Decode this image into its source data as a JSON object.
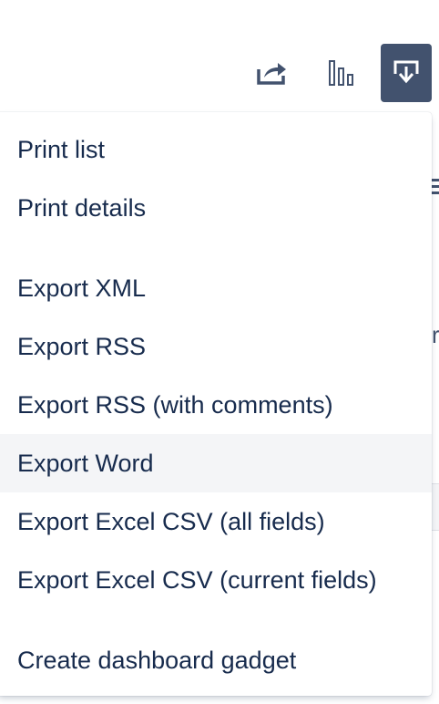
{
  "toolbar": {
    "icons": [
      "share-icon",
      "chart-icon",
      "export-icon"
    ],
    "export_button_color": "#42526e",
    "icon_color": "#42526e"
  },
  "background": {
    "partial_text": "r"
  },
  "dropdown": {
    "print_items": [
      {
        "label": "Print list"
      },
      {
        "label": "Print details"
      }
    ],
    "export_items": [
      {
        "label": "Export XML"
      },
      {
        "label": "Export RSS"
      },
      {
        "label": "Export RSS (with comments)"
      },
      {
        "label": "Export Word",
        "highlighted": true
      },
      {
        "label": "Export Excel CSV (all fields)"
      },
      {
        "label": "Export Excel CSV (current fields)"
      }
    ],
    "gadget_items": [
      {
        "label": "Create dashboard gadget"
      }
    ],
    "highlight_color": "#f4f5f7",
    "text_color": "#172b4d"
  }
}
